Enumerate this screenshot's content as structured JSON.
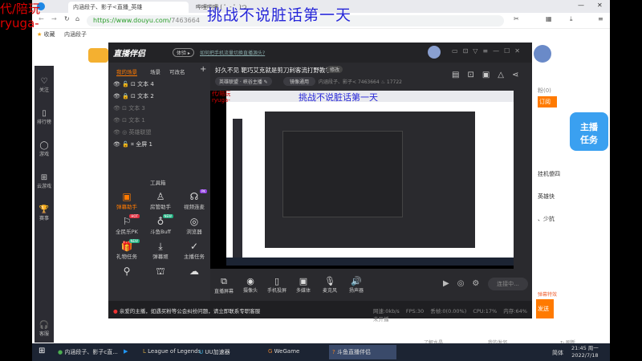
{
  "overlay": {
    "red_line1": "代/陪玩",
    "red_line2": "ryuga-",
    "blue_text": "挑战不说脏话第一天"
  },
  "browser": {
    "tabs": [
      {
        "label": "内涵段子、影子<直播_英雄"
      },
      {
        "label": "哔哩哔哩 ( ゜- ゜)つロ"
      }
    ],
    "url_host": "https://www.douyu.com/",
    "url_path": "7463664",
    "bookmarks": {
      "star": "收藏",
      "item": "内涵段子"
    }
  },
  "douyu_sidebar": [
    {
      "icon": "♡",
      "label": "关注"
    },
    {
      "icon": "▯",
      "label": "排行榜"
    },
    {
      "icon": "◯",
      "label": "游戏"
    },
    {
      "icon": "⊞",
      "label": "云游戏"
    },
    {
      "icon": "🏆",
      "label": "赛事"
    },
    {
      "icon": "🎧",
      "label": "客服"
    }
  ],
  "app": {
    "logo": "直播伴侣",
    "version_badge": "体验 ▸",
    "help_link": "如何把手机流量切换直播源头?",
    "window_controls": [
      "▭",
      "⊡",
      "▽",
      "≡",
      "—",
      "☐",
      "✕"
    ],
    "scene_tabs": [
      "我的场景",
      "场景",
      "可改名",
      "+"
    ],
    "layers": [
      {
        "name": "文本 4",
        "dim": false
      },
      {
        "name": "文本 2",
        "dim": false
      },
      {
        "name": "文本 3",
        "dim": true
      },
      {
        "name": "文本 1",
        "dim": true
      },
      {
        "name": "英雄联盟",
        "dim": true
      },
      {
        "name": "全屏 1",
        "dim": false
      }
    ],
    "stream_title": "好久不见 靶巧艾克就是剪刀刺客流打野教学",
    "edit_label": "修改",
    "category": "英雄联盟 · 峡谷主播 ✎",
    "quality": "镜像通用",
    "streamer": "内涵段子、影子<",
    "room_id": "7463664",
    "heat": "17722",
    "toolbox_title": "工具箱",
    "tools": [
      {
        "icon": "▣",
        "label": "弹幕助手",
        "badge": "",
        "active": true
      },
      {
        "icon": "♙",
        "label": "房管助手",
        "badge": ""
      },
      {
        "icon": "☊",
        "label": "视频连麦",
        "badge": "PK"
      },
      {
        "icon": "⚐",
        "label": "全民乐PK",
        "badge": "HOT"
      },
      {
        "icon": "♁",
        "label": "斗鱼Buff",
        "badge": "NEW"
      },
      {
        "icon": "◎",
        "label": "浏览器",
        "badge": ""
      },
      {
        "icon": "🎁",
        "label": "礼物任务",
        "badge": "NEW"
      },
      {
        "icon": "⤓",
        "label": "弹幕姬",
        "badge": ""
      },
      {
        "icon": "✓",
        "label": "主播任务",
        "badge": ""
      },
      {
        "icon": "⚲",
        "label": "",
        "badge": ""
      },
      {
        "icon": "⛫",
        "label": "",
        "badge": ""
      },
      {
        "icon": "☁",
        "label": "",
        "badge": ""
      }
    ],
    "bottom_tools": [
      {
        "icon": "⧉",
        "label": "直播屏幕"
      },
      {
        "icon": "◉",
        "label": "摄像头"
      },
      {
        "icon": "▯",
        "label": "手机投屏"
      },
      {
        "icon": "▣",
        "label": "多媒体"
      },
      {
        "icon": "🎙",
        "label": "麦克风"
      },
      {
        "icon": "🔊",
        "label": "扬声器"
      }
    ],
    "connect_label": "连接中...",
    "notice": "亲爱的主播，如遇买粉等公会纠纷问题，请立即联系专职客服",
    "stats": {
      "net": "网速:0kb/s",
      "fps": "FPS:30",
      "drop": "丢帧:0(0.00%)",
      "cpu": "CPU:17%",
      "mem": "内存:64%",
      "status": "未开播"
    }
  },
  "chat": {
    "follow": "粉(0)",
    "subscribe": "订阅",
    "lines": [
      "挂机傻四",
      "英雄快",
      "、少抗"
    ],
    "prompt": "弹幕特效",
    "send": "发送",
    "footer_left": "了解水晶",
    "footer_mid": "我的发邻",
    "refresh": "刷新"
  },
  "taskbar": {
    "items": [
      {
        "label": "内涵段子、影子c直...",
        "icon": "●",
        "color": "#4caf50"
      },
      {
        "label": "",
        "icon": "▶",
        "color": "#2196f3"
      },
      {
        "label": "League of Legends",
        "icon": "L",
        "color": "#c8a040"
      },
      {
        "label": "UU加速器",
        "icon": "U",
        "color": "#3ab0e0"
      },
      {
        "label": "WeGame",
        "icon": "G",
        "color": "#e08030"
      },
      {
        "label": "斗鱼直播伴侣",
        "icon": "?",
        "color": "#f08020"
      }
    ],
    "lang": "简体",
    "time": "21:45 周一",
    "date": "2022/7/18"
  },
  "colors": {
    "accent": "#ff7a00",
    "app_bg": "#2a2a2e"
  }
}
